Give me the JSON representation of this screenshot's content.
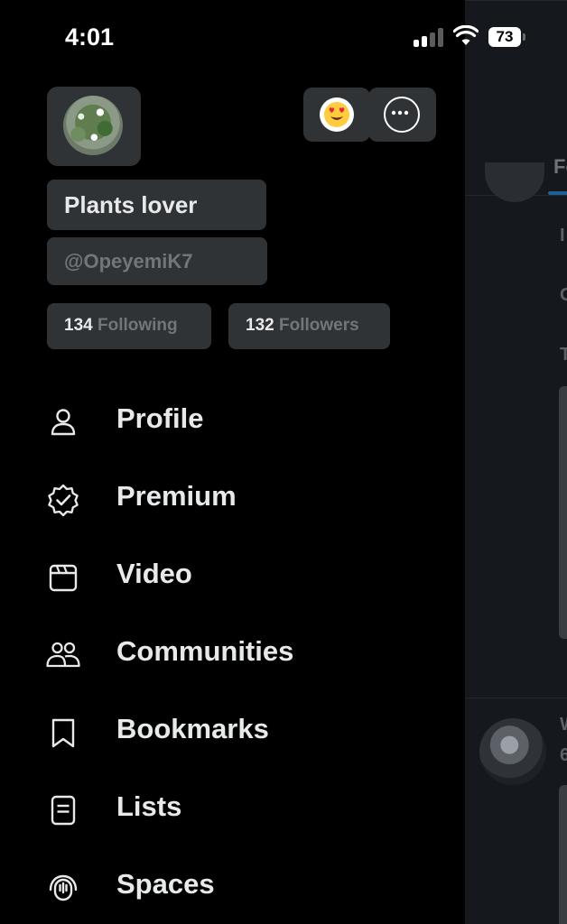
{
  "status_bar": {
    "time": "4:01",
    "battery": "73"
  },
  "profile": {
    "display_name": "Plants lover",
    "handle": "@OpeyemiK7",
    "following_count": "134",
    "following_label": "Following",
    "followers_count": "132",
    "followers_label": "Followers"
  },
  "menu": [
    {
      "label": "Profile",
      "icon": "person-icon"
    },
    {
      "label": "Premium",
      "icon": "verified-badge-icon"
    },
    {
      "label": "Video",
      "icon": "video-clapper-icon"
    },
    {
      "label": "Communities",
      "icon": "communities-icon"
    },
    {
      "label": "Bookmarks",
      "icon": "bookmark-icon"
    },
    {
      "label": "Lists",
      "icon": "list-icon"
    },
    {
      "label": "Spaces",
      "icon": "spaces-microphone-icon"
    }
  ],
  "background_timeline": {
    "tab_fragment": "Fo",
    "text_fragments": [
      "I",
      "C",
      "T",
      "W",
      "6"
    ]
  }
}
